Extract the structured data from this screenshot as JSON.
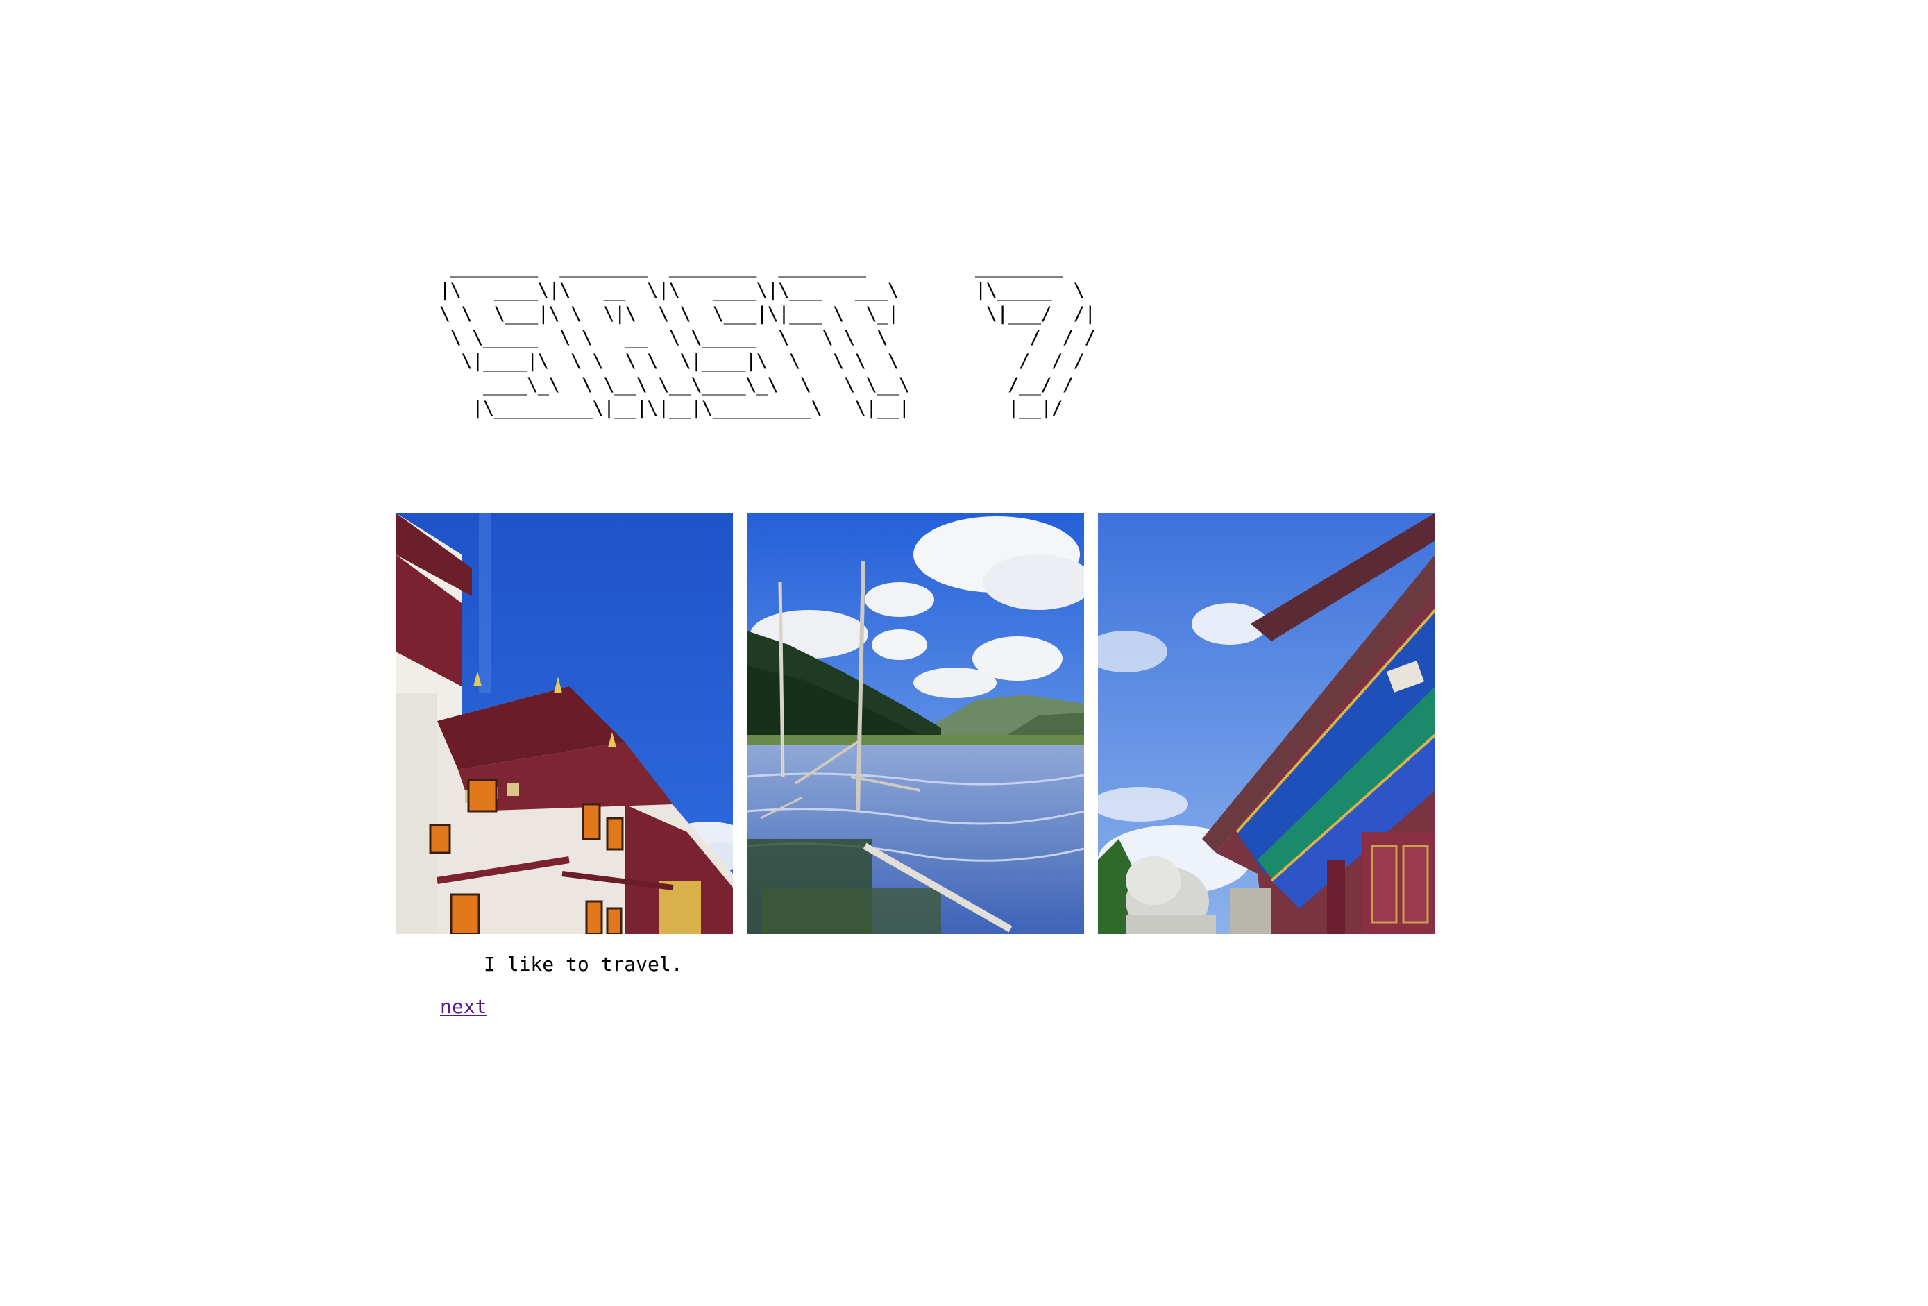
{
  "header": {
    "ascii_title": " ________  ________  ________  ________          ________     \n|\\   ____\\|\\   __  \\|\\   ____\\|\\___   ___\\       |\\_____  \\    \n\\ \\  \\___|\\ \\  \\|\\  \\ \\  \\___|\\|___ \\  \\_|        \\|___/  /|   \n \\ \\_____  \\ \\   __  \\ \\_____  \\   \\ \\  \\             /  / /   \n  \\|____|\\  \\ \\  \\ \\  \\|____|\\  \\   \\ \\  \\           /  / /    \n    ____\\_\\  \\ \\__\\ \\__\\____\\_\\  \\   \\ \\__\\         /__/ /     \n   |\\_________\\|__|\\|__|\\_________\\   \\|__|         |__|/      "
  },
  "gallery": {
    "photos": [
      {
        "icon": "monastery-photo"
      },
      {
        "icon": "lake-photo"
      },
      {
        "icon": "temple-photo"
      }
    ]
  },
  "caption": "I like to travel.",
  "nav": {
    "next_label": "next"
  }
}
